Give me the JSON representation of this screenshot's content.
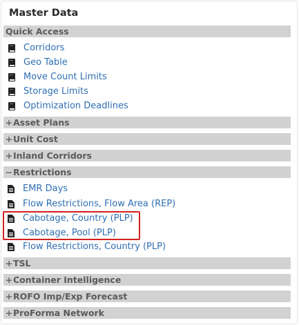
{
  "panel": {
    "title": "Master Data"
  },
  "sections": {
    "quick_access": {
      "label": "Quick Access"
    },
    "asset_plans": {
      "label": "Asset Plans",
      "state": "+"
    },
    "unit_cost": {
      "label": "Unit Cost",
      "state": "+"
    },
    "inland_corridors": {
      "label": "Inland Corridors",
      "state": "+"
    },
    "restrictions": {
      "label": "Restrictions",
      "state": "−"
    },
    "tsl": {
      "label": "TSL",
      "state": "+"
    },
    "container_intelligence": {
      "label": "Container Intelligence",
      "state": "+"
    },
    "rofo": {
      "label": "ROFO Imp/Exp Forecast",
      "state": "+"
    },
    "proforma": {
      "label": "ProForma Network",
      "state": "+"
    }
  },
  "quick_items": [
    {
      "label": "Corridors",
      "icon": "book-icon"
    },
    {
      "label": "Geo Table",
      "icon": "book-icon"
    },
    {
      "label": "Move Count Limits",
      "icon": "book-icon"
    },
    {
      "label": "Storage Limits",
      "icon": "book-icon"
    },
    {
      "label": "Optimization Deadlines",
      "icon": "book-icon"
    }
  ],
  "restriction_items": [
    {
      "label": "EMR Days",
      "icon": "document-icon"
    },
    {
      "label": "Flow Restrictions, Flow Area (REP)",
      "icon": "document-icon"
    },
    {
      "label": "Cabotage, Country (PLP)",
      "icon": "document-icon"
    },
    {
      "label": "Cabotage, Pool (PLP)",
      "icon": "document-icon"
    },
    {
      "label": "Flow Restrictions, Country (PLP)",
      "icon": "document-icon"
    }
  ],
  "colors": {
    "link": "#2e6fb4",
    "section_bg": "#d2d2d2",
    "highlight_border": "#d21f1f"
  }
}
